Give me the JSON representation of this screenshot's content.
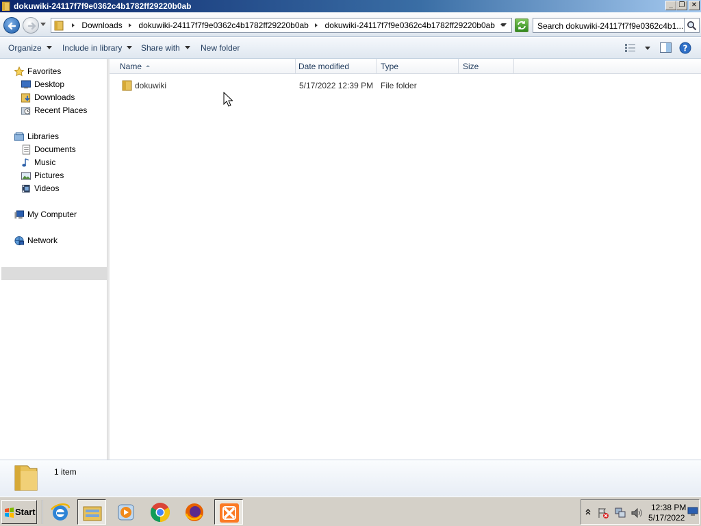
{
  "window": {
    "title": "dokuwiki-24117f7f9e0362c4b1782ff29220b0ab",
    "minimize_glyph": "_",
    "restore_glyph": "❐",
    "close_glyph": "✕"
  },
  "address": {
    "crumbs": [
      "Downloads",
      "dokuwiki-24117f7f9e0362c4b1782ff29220b0ab",
      "dokuwiki-24117f7f9e0362c4b1782ff29220b0ab"
    ],
    "search_placeholder": "Search dokuwiki-24117f7f9e0362c4b1..."
  },
  "toolbar": {
    "organize": "Organize",
    "include_in_library": "Include in library",
    "share_with": "Share with",
    "new_folder": "New folder"
  },
  "sidebar": {
    "favorites": {
      "label": "Favorites",
      "icon": "star-icon"
    },
    "favorites_items": [
      {
        "label": "Desktop",
        "icon": "desktop-icon"
      },
      {
        "label": "Downloads",
        "icon": "downloads-icon"
      },
      {
        "label": "Recent Places",
        "icon": "recent-places-icon"
      }
    ],
    "libraries": {
      "label": "Libraries",
      "icon": "libraries-icon"
    },
    "libraries_items": [
      {
        "label": "Documents",
        "icon": "documents-icon"
      },
      {
        "label": "Music",
        "icon": "music-icon"
      },
      {
        "label": "Pictures",
        "icon": "pictures-icon"
      },
      {
        "label": "Videos",
        "icon": "videos-icon"
      }
    ],
    "computer": {
      "label": "My Computer",
      "icon": "computer-icon",
      "selected": true
    },
    "network": {
      "label": "Network",
      "icon": "network-icon"
    }
  },
  "columns": {
    "name": "Name",
    "date_modified": "Date modified",
    "type": "Type",
    "size": "Size"
  },
  "files": [
    {
      "name": "dokuwiki",
      "date_modified": "5/17/2022 12:39 PM",
      "type": "File folder",
      "size": ""
    }
  ],
  "details": {
    "count": "1 item"
  },
  "taskbar": {
    "start": "Start",
    "apps": [
      "internet-explorer-icon",
      "windows-explorer-icon",
      "media-player-icon",
      "chrome-icon",
      "firefox-icon",
      "xampp-icon"
    ],
    "clock_time": "12:38 PM",
    "clock_date": "5/17/2022"
  },
  "colors": {
    "title_bar": "#0a246a",
    "selection": "#dcdcdc",
    "folder": "#e8c25a",
    "link_text": "#1e395b"
  }
}
